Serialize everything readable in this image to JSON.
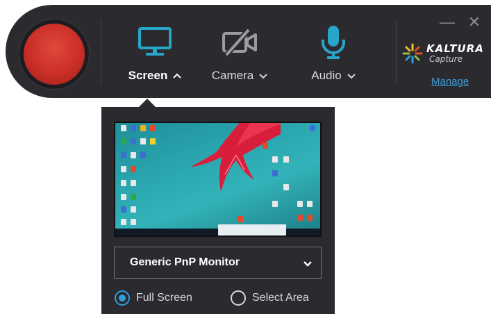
{
  "toolbar": {
    "sources": {
      "screen": {
        "label": "Screen",
        "expanded": true
      },
      "camera": {
        "label": "Camera",
        "enabled": false
      },
      "audio": {
        "label": "Audio"
      }
    },
    "manage_link": "Manage",
    "logo": {
      "brand": "KALTURA",
      "product": "Capture"
    },
    "window_controls": {
      "minimize": "—",
      "close": "✕"
    }
  },
  "screen_panel": {
    "monitor_select": {
      "selected": "Generic PnP Monitor"
    },
    "capture_mode": {
      "options": [
        {
          "label": "Full Screen",
          "checked": true
        },
        {
          "label": "Select Area",
          "checked": false
        }
      ]
    }
  },
  "colors": {
    "bar_bg": "#2b2a2f",
    "record_red": "#c92e27",
    "accent_blue": "#2d9fdd",
    "screen_icon_teal": "#27a6c9",
    "link_blue": "#3d9bd6"
  },
  "icons": {
    "screen": "monitor-icon",
    "camera": "camera-off-icon",
    "audio": "microphone-icon",
    "chevron_up": "chevron-up-icon",
    "chevron_down": "chevron-down-icon"
  }
}
